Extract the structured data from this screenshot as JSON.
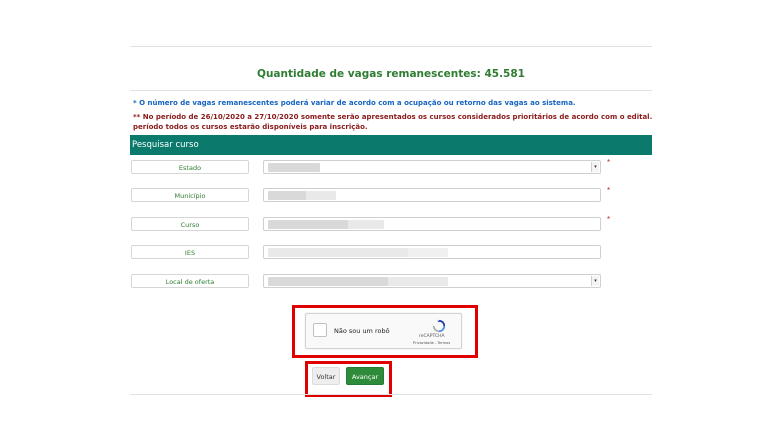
{
  "header": {
    "title": "Quantidade de vagas remanescentes: 45.581"
  },
  "notes": {
    "blue": "* O número de vagas remanescentes poderá variar de acordo com a ocupação ou retorno das vagas ao sistema.",
    "red_line1": "** No período de 26/10/2020 a 27/10/2020 somente serão apresentados os cursos considerados prioritários de acordo com o edital. Após este",
    "red_line2": "período todos os cursos estarão disponíveis para inscrição."
  },
  "search": {
    "title": "Pesquisar curso",
    "fields": [
      {
        "label": "Estado",
        "required_mark": "*",
        "type": "select"
      },
      {
        "label": "Município",
        "required_mark": "*",
        "type": "text"
      },
      {
        "label": "Curso",
        "required_mark": "*",
        "type": "text"
      },
      {
        "label": "IES",
        "required_mark": "",
        "type": "text"
      },
      {
        "label": "Local de oferta",
        "required_mark": "",
        "type": "select"
      }
    ]
  },
  "captcha": {
    "label": "Não sou um robô",
    "brand": "reCAPTCHA",
    "links": "Privacidade - Termos"
  },
  "buttons": {
    "back": "Voltar",
    "next": "Avançar"
  },
  "colors": {
    "title_green": "#2e7d32",
    "note_blue": "#1565c0",
    "note_red": "#8b1a1a",
    "bar_teal": "#0b7a6c",
    "highlight_red": "#e10000",
    "next_button": "#2e8b3a"
  },
  "icons": {
    "captcha_logo": "recaptcha-icon",
    "select_arrow": "chevron-down-icon"
  }
}
